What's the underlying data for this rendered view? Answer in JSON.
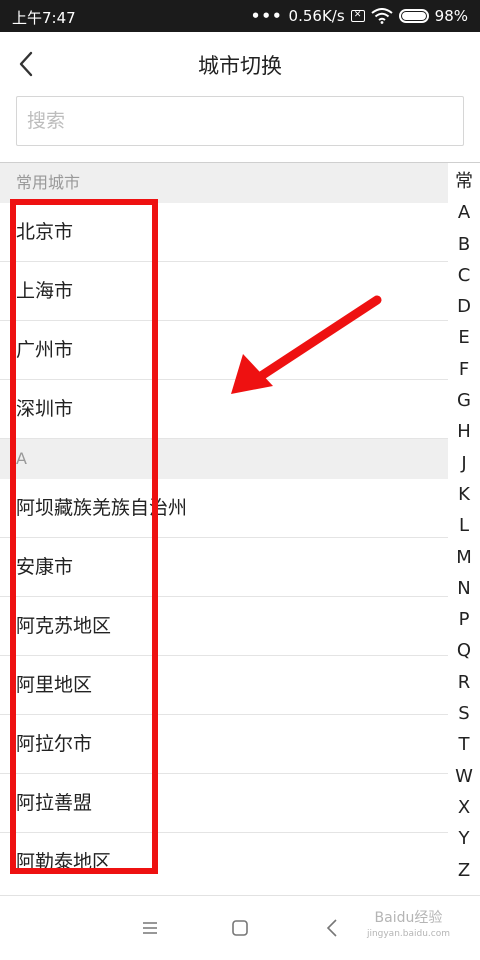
{
  "status_bar": {
    "time": "上午7:47",
    "network_speed": "0.56K/s",
    "battery": "98%",
    "battery_level": 0.98,
    "icons": [
      "signal-dots-icon",
      "no-sim-icon",
      "wifi-icon",
      "battery-icon"
    ]
  },
  "header": {
    "title": "城市切换",
    "back_icon": "chevron-left-icon"
  },
  "search": {
    "placeholder": "搜索"
  },
  "sections": [
    {
      "title": "常用城市",
      "items": [
        "北京市",
        "上海市",
        "广州市",
        "深圳市"
      ]
    },
    {
      "title": "A",
      "items": [
        "阿坝藏族羌族自治州",
        "安康市",
        "阿克苏地区",
        "阿里地区",
        "阿拉尔市",
        "阿拉善盟",
        "阿勒泰地区"
      ]
    }
  ],
  "index": [
    "常",
    "A",
    "B",
    "C",
    "D",
    "E",
    "F",
    "G",
    "H",
    "J",
    "K",
    "L",
    "M",
    "N",
    "P",
    "Q",
    "R",
    "S",
    "T",
    "W",
    "X",
    "Y",
    "Z"
  ],
  "annotation": {
    "color": "#ee1111"
  },
  "navbar": {
    "icons": [
      "menu-icon",
      "home-square-icon",
      "back-triangle-icon"
    ]
  },
  "watermark": {
    "text": "Baidu经验",
    "sub": "jingyan.baidu.com"
  }
}
